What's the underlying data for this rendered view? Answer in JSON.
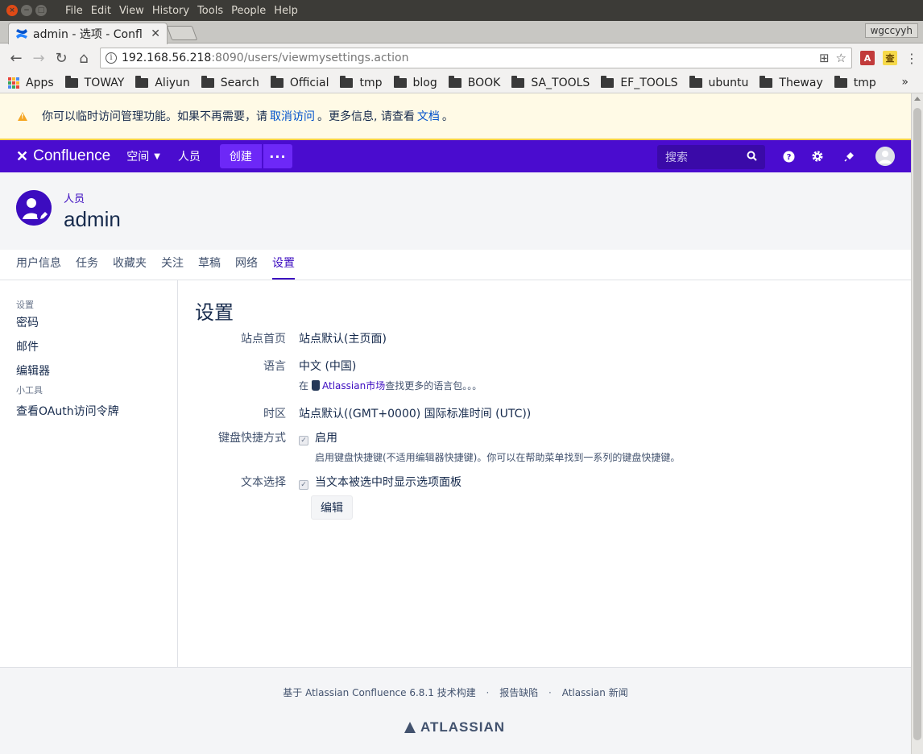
{
  "os": {
    "menu": [
      "File",
      "Edit",
      "View",
      "History",
      "Tools",
      "People",
      "Help"
    ]
  },
  "browser": {
    "tab_title": "admin - 选项 - Confl",
    "profile_name": "wgccyyh",
    "url_host": "192.168.56.218",
    "url_rest": ":8090/users/viewmysettings.action",
    "bookmarks": [
      {
        "label": "Apps",
        "icon": "apps-grid-icon"
      },
      {
        "label": "TOWAY",
        "icon": "folder-icon"
      },
      {
        "label": "Aliyun",
        "icon": "folder-icon"
      },
      {
        "label": "Search",
        "icon": "folder-icon"
      },
      {
        "label": "Official",
        "icon": "folder-icon"
      },
      {
        "label": "tmp",
        "icon": "folder-icon"
      },
      {
        "label": "blog",
        "icon": "folder-icon"
      },
      {
        "label": "BOOK",
        "icon": "folder-icon"
      },
      {
        "label": "SA_TOOLS",
        "icon": "folder-icon"
      },
      {
        "label": "EF_TOOLS",
        "icon": "folder-icon"
      },
      {
        "label": "ubuntu",
        "icon": "folder-icon"
      },
      {
        "label": "Theway",
        "icon": "folder-icon"
      },
      {
        "label": "tmp",
        "icon": "folder-icon"
      }
    ],
    "bookmarks_more": "»"
  },
  "banner": {
    "text_before": "你可以临时访问管理功能。如果不再需要，请",
    "link1": "取消访问",
    "text_middle": "。更多信息, 请查看",
    "link2": "文档",
    "text_after": "。"
  },
  "header": {
    "product": "Confluence",
    "nav_spaces": "空间",
    "nav_people": "人员",
    "create": "创建",
    "more": "···",
    "search_placeholder": "搜索",
    "accent_color": "#4a0ccf"
  },
  "profile": {
    "breadcrumb": "人员",
    "name": "admin"
  },
  "tabs": [
    {
      "label": "用户信息",
      "active": false
    },
    {
      "label": "任务",
      "active": false
    },
    {
      "label": "收藏夹",
      "active": false
    },
    {
      "label": "关注",
      "active": false
    },
    {
      "label": "草稿",
      "active": false
    },
    {
      "label": "网络",
      "active": false
    },
    {
      "label": "设置",
      "active": true
    }
  ],
  "sidebar": {
    "heading_settings": "设置",
    "items": [
      "密码",
      "邮件",
      "编辑器"
    ],
    "heading_tools": "小工具",
    "tool_items": [
      "查看OAuth访问令牌"
    ]
  },
  "settings": {
    "title": "设置",
    "homepage_label": "站点首页",
    "homepage_value": "站点默认(主页面)",
    "language_label": "语言",
    "language_value": "中文 (中国)",
    "language_sub_prefix": "在",
    "language_sub_link": "Atlassian市场",
    "language_sub_suffix": "查找更多的语言包。。。",
    "timezone_label": "时区",
    "timezone_value": "站点默认((GMT+0000) 国际标准时间 (UTC))",
    "shortcuts_label": "键盘快捷方式",
    "shortcuts_value": "启用",
    "shortcuts_sub": "启用键盘快捷键(不适用编辑器快捷键)。你可以在帮助菜单找到一系列的键盘快捷键。",
    "textsel_label": "文本选择",
    "textsel_value": "当文本被选中时显示选项面板",
    "edit_button": "编辑"
  },
  "footer": {
    "built_on": "基于 Atlassian Confluence 6.8.1 技术构建",
    "report_bug": "报告缺陷",
    "news": "Atlassian 新闻",
    "logo_text": "ATLASSIAN"
  }
}
